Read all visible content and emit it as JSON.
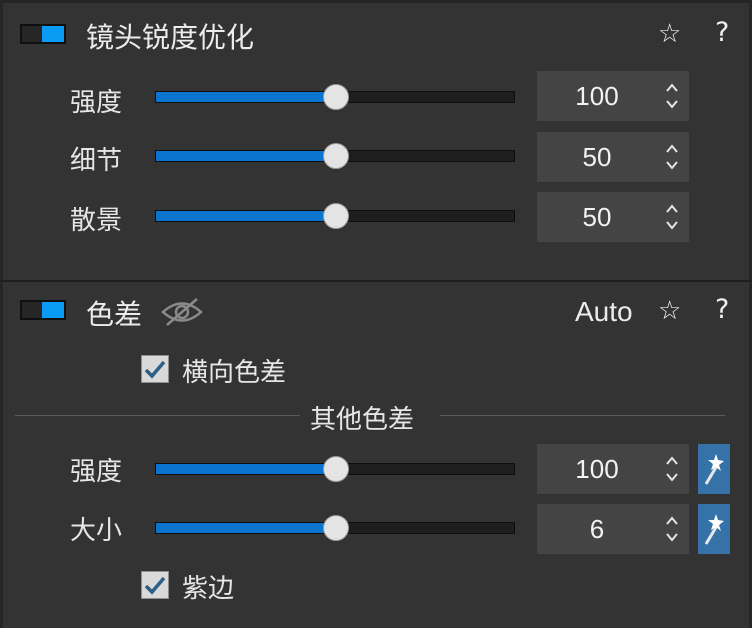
{
  "lens_sharpness": {
    "title": "镜头锐度优化",
    "enabled": true,
    "rows": [
      {
        "label": "强度",
        "value": "100",
        "level": 0.5
      },
      {
        "label": "细节",
        "value": "50",
        "level": 0.5
      },
      {
        "label": "散景",
        "value": "50",
        "level": 0.5
      }
    ]
  },
  "chromatic_aberration": {
    "title": "色差",
    "enabled": true,
    "auto_label": "Auto",
    "lateral_checkbox": {
      "label": "横向色差",
      "checked": true
    },
    "other_header": "其他色差",
    "rows": [
      {
        "label": "强度",
        "value": "100",
        "level": 0.5
      },
      {
        "label": "大小",
        "value": "6",
        "level": 0.5
      }
    ],
    "purple_fringe_checkbox": {
      "label": "紫边",
      "checked": true
    }
  },
  "icons": {
    "favorite": "☆",
    "help": "?",
    "visibility": "eye-crossed-icon",
    "auto_wand": "magic-wand-icon",
    "spinner": "up-down-arrows-icon"
  },
  "colors": {
    "accent_blue": "#0a9cf5",
    "slider_fill": "#0b74cf",
    "wand_bg": "#3572a8",
    "panel_bg": "#333333"
  }
}
